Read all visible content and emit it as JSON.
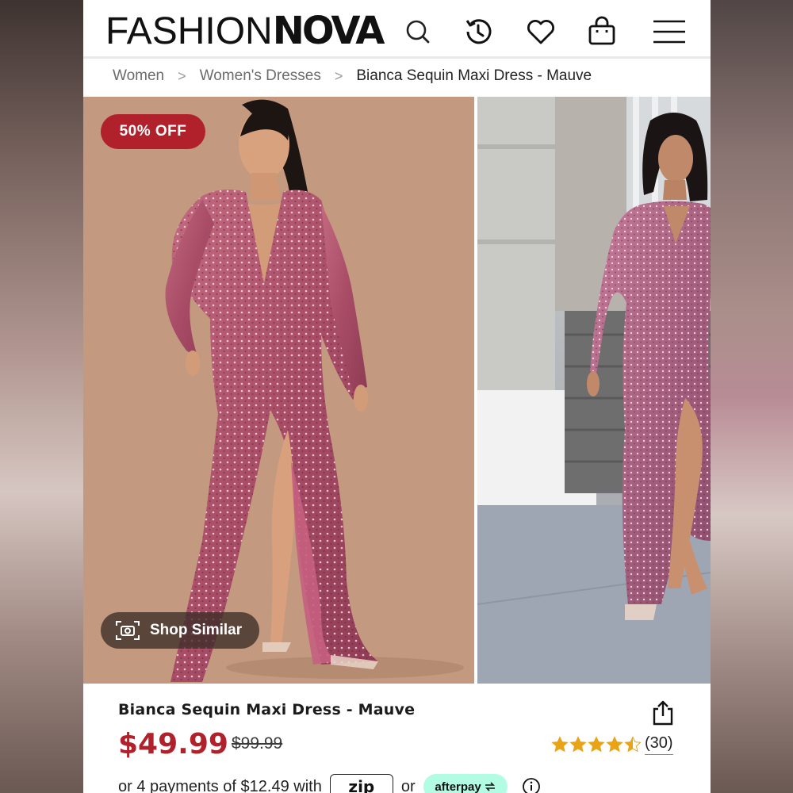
{
  "header": {
    "logo_thin": "FASHION",
    "logo_bold": "NOVA",
    "icons": [
      "search-icon",
      "history-icon",
      "heart-icon",
      "bag-icon",
      "menu-icon"
    ]
  },
  "breadcrumb": {
    "items": [
      "Women",
      "Women's Dresses"
    ],
    "current": "Bianca Sequin Maxi Dress - Mauve",
    "separator": ">"
  },
  "gallery": {
    "badge": "50% OFF",
    "shop_similar": "Shop Similar"
  },
  "product": {
    "name": "Bianca Sequin Maxi Dress - Mauve",
    "price": "$49.99",
    "original_price": "$99.99",
    "rating": 4.5,
    "reviews": "(30)",
    "payments_text": "or 4 payments of $12.49 with",
    "payments_or": "or",
    "zip_label": "zip",
    "afterpay_label": "afterpay"
  },
  "colors": {
    "sale_red": "#b0212b",
    "star_gold": "#e8a317",
    "afterpay_mint": "#b2fce4"
  }
}
